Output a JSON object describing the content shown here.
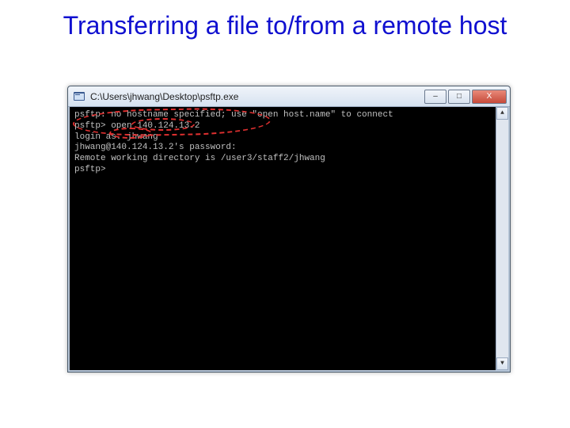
{
  "slide": {
    "title": "Transferring a file to/from a remote host"
  },
  "window": {
    "title_path": "C:\\Users\\jhwang\\Desktop\\psftp.exe",
    "buttons": {
      "min": "–",
      "max": "□",
      "close": "X"
    }
  },
  "terminal": {
    "lines": [
      "psftp: no hostname specified; use \"open host.name\" to connect",
      "psftp> open 140.124.13.2",
      "login as: jhwang",
      "jhwang@140.124.13.2's password:",
      "Remote working directory is /user3/staff2/jhwang",
      "psftp>"
    ]
  }
}
